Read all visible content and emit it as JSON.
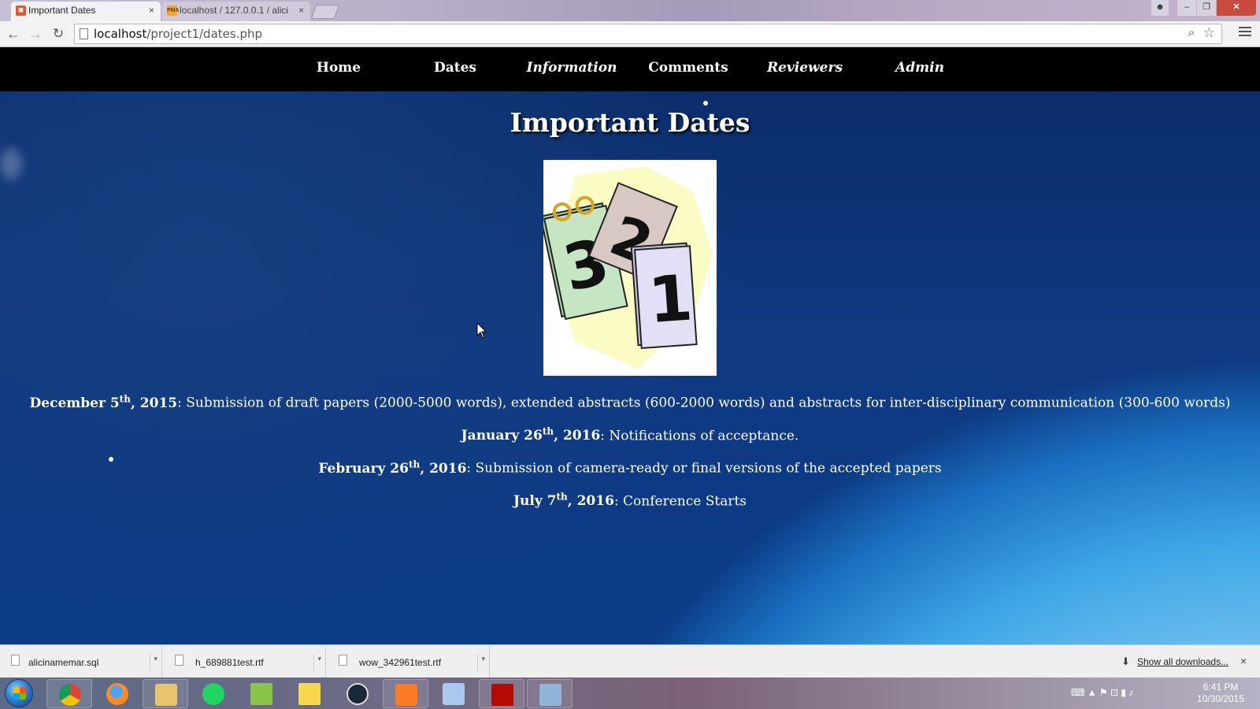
{
  "browser": {
    "tabs": [
      {
        "title": "Important Dates",
        "favicon": "xampp-icon",
        "active": true
      },
      {
        "title": "localhost / 127.0.0.1 / alici",
        "favicon": "phpmyadmin-icon",
        "active": false
      }
    ],
    "tab_close_glyph": "×",
    "url_host": "localhost",
    "url_path": "/project1/dates.php",
    "nav_icons": {
      "back": "←",
      "forward": "→",
      "reload": "↻",
      "zoom": "⌕",
      "star": "☆"
    },
    "window_controls": {
      "minimize": "–",
      "maximize": "❐",
      "close": "✕"
    }
  },
  "site": {
    "nav": [
      {
        "label": "Home",
        "italic": false
      },
      {
        "label": "Dates",
        "italic": false
      },
      {
        "label": "Information",
        "italic": true
      },
      {
        "label": "Comments",
        "italic": false
      },
      {
        "label": "Reviewers",
        "italic": true
      },
      {
        "label": "Admin",
        "italic": true
      }
    ],
    "page_title": "Important Dates",
    "image_icon": "calendar-countdown-clipart",
    "dates": [
      {
        "month": "December 5",
        "sup": "th",
        "year": ", 2015",
        "desc": ": Submission of draft papers (2000-5000 words), extended abstracts (600-2000 words) and abstracts for inter-disciplinary communication (300-600 words)"
      },
      {
        "month": "January 26",
        "sup": "th",
        "year": ", 2016",
        "desc": ": Notifications of acceptance."
      },
      {
        "month": "February 26",
        "sup": "th",
        "year": ", 2016",
        "desc": ": Submission of camera-ready or final versions of the accepted papers"
      },
      {
        "month": "July 7",
        "sup": "th",
        "year": ", 2016",
        "desc": ": Conference Starts"
      }
    ]
  },
  "downloads": {
    "items": [
      "alicinamemar.sql",
      "h_689881test.rtf",
      "wow_342961test.rtf"
    ],
    "show_all_label": "Show all downloads...",
    "close_glyph": "×"
  },
  "taskbar": {
    "apps": [
      "chrome-icon",
      "firefox-icon",
      "file-explorer-icon",
      "spotify-icon",
      "notepad-icon",
      "windows-live-icon",
      "steam-icon",
      "xampp-icon",
      "virtualbox-icon",
      "acrobat-icon",
      "control-panel-icon"
    ],
    "clock_time": "6:41 PM",
    "clock_date": "10/30/2015"
  },
  "colors": {
    "nav_bg": "#000000",
    "page_text": "#ffffff",
    "chrome_close": "#c94b3f"
  }
}
